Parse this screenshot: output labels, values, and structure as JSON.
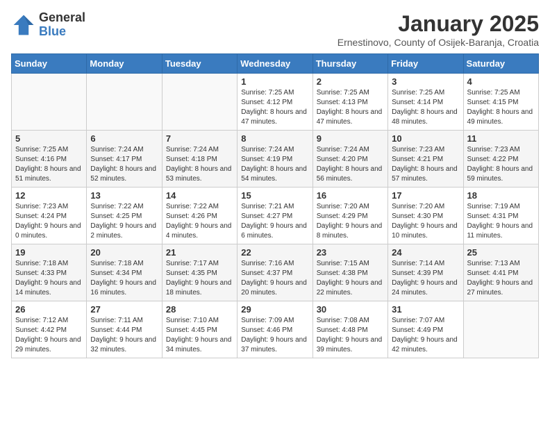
{
  "header": {
    "logo_general": "General",
    "logo_blue": "Blue",
    "month_title": "January 2025",
    "subtitle": "Ernestinovo, County of Osijek-Baranja, Croatia"
  },
  "weekdays": [
    "Sunday",
    "Monday",
    "Tuesday",
    "Wednesday",
    "Thursday",
    "Friday",
    "Saturday"
  ],
  "weeks": [
    [
      {
        "day": "",
        "info": ""
      },
      {
        "day": "",
        "info": ""
      },
      {
        "day": "",
        "info": ""
      },
      {
        "day": "1",
        "info": "Sunrise: 7:25 AM\nSunset: 4:12 PM\nDaylight: 8 hours and 47 minutes."
      },
      {
        "day": "2",
        "info": "Sunrise: 7:25 AM\nSunset: 4:13 PM\nDaylight: 8 hours and 47 minutes."
      },
      {
        "day": "3",
        "info": "Sunrise: 7:25 AM\nSunset: 4:14 PM\nDaylight: 8 hours and 48 minutes."
      },
      {
        "day": "4",
        "info": "Sunrise: 7:25 AM\nSunset: 4:15 PM\nDaylight: 8 hours and 49 minutes."
      }
    ],
    [
      {
        "day": "5",
        "info": "Sunrise: 7:25 AM\nSunset: 4:16 PM\nDaylight: 8 hours and 51 minutes."
      },
      {
        "day": "6",
        "info": "Sunrise: 7:24 AM\nSunset: 4:17 PM\nDaylight: 8 hours and 52 minutes."
      },
      {
        "day": "7",
        "info": "Sunrise: 7:24 AM\nSunset: 4:18 PM\nDaylight: 8 hours and 53 minutes."
      },
      {
        "day": "8",
        "info": "Sunrise: 7:24 AM\nSunset: 4:19 PM\nDaylight: 8 hours and 54 minutes."
      },
      {
        "day": "9",
        "info": "Sunrise: 7:24 AM\nSunset: 4:20 PM\nDaylight: 8 hours and 56 minutes."
      },
      {
        "day": "10",
        "info": "Sunrise: 7:23 AM\nSunset: 4:21 PM\nDaylight: 8 hours and 57 minutes."
      },
      {
        "day": "11",
        "info": "Sunrise: 7:23 AM\nSunset: 4:22 PM\nDaylight: 8 hours and 59 minutes."
      }
    ],
    [
      {
        "day": "12",
        "info": "Sunrise: 7:23 AM\nSunset: 4:24 PM\nDaylight: 9 hours and 0 minutes."
      },
      {
        "day": "13",
        "info": "Sunrise: 7:22 AM\nSunset: 4:25 PM\nDaylight: 9 hours and 2 minutes."
      },
      {
        "day": "14",
        "info": "Sunrise: 7:22 AM\nSunset: 4:26 PM\nDaylight: 9 hours and 4 minutes."
      },
      {
        "day": "15",
        "info": "Sunrise: 7:21 AM\nSunset: 4:27 PM\nDaylight: 9 hours and 6 minutes."
      },
      {
        "day": "16",
        "info": "Sunrise: 7:20 AM\nSunset: 4:29 PM\nDaylight: 9 hours and 8 minutes."
      },
      {
        "day": "17",
        "info": "Sunrise: 7:20 AM\nSunset: 4:30 PM\nDaylight: 9 hours and 10 minutes."
      },
      {
        "day": "18",
        "info": "Sunrise: 7:19 AM\nSunset: 4:31 PM\nDaylight: 9 hours and 11 minutes."
      }
    ],
    [
      {
        "day": "19",
        "info": "Sunrise: 7:18 AM\nSunset: 4:33 PM\nDaylight: 9 hours and 14 minutes."
      },
      {
        "day": "20",
        "info": "Sunrise: 7:18 AM\nSunset: 4:34 PM\nDaylight: 9 hours and 16 minutes."
      },
      {
        "day": "21",
        "info": "Sunrise: 7:17 AM\nSunset: 4:35 PM\nDaylight: 9 hours and 18 minutes."
      },
      {
        "day": "22",
        "info": "Sunrise: 7:16 AM\nSunset: 4:37 PM\nDaylight: 9 hours and 20 minutes."
      },
      {
        "day": "23",
        "info": "Sunrise: 7:15 AM\nSunset: 4:38 PM\nDaylight: 9 hours and 22 minutes."
      },
      {
        "day": "24",
        "info": "Sunrise: 7:14 AM\nSunset: 4:39 PM\nDaylight: 9 hours and 24 minutes."
      },
      {
        "day": "25",
        "info": "Sunrise: 7:13 AM\nSunset: 4:41 PM\nDaylight: 9 hours and 27 minutes."
      }
    ],
    [
      {
        "day": "26",
        "info": "Sunrise: 7:12 AM\nSunset: 4:42 PM\nDaylight: 9 hours and 29 minutes."
      },
      {
        "day": "27",
        "info": "Sunrise: 7:11 AM\nSunset: 4:44 PM\nDaylight: 9 hours and 32 minutes."
      },
      {
        "day": "28",
        "info": "Sunrise: 7:10 AM\nSunset: 4:45 PM\nDaylight: 9 hours and 34 minutes."
      },
      {
        "day": "29",
        "info": "Sunrise: 7:09 AM\nSunset: 4:46 PM\nDaylight: 9 hours and 37 minutes."
      },
      {
        "day": "30",
        "info": "Sunrise: 7:08 AM\nSunset: 4:48 PM\nDaylight: 9 hours and 39 minutes."
      },
      {
        "day": "31",
        "info": "Sunrise: 7:07 AM\nSunset: 4:49 PM\nDaylight: 9 hours and 42 minutes."
      },
      {
        "day": "",
        "info": ""
      }
    ]
  ]
}
